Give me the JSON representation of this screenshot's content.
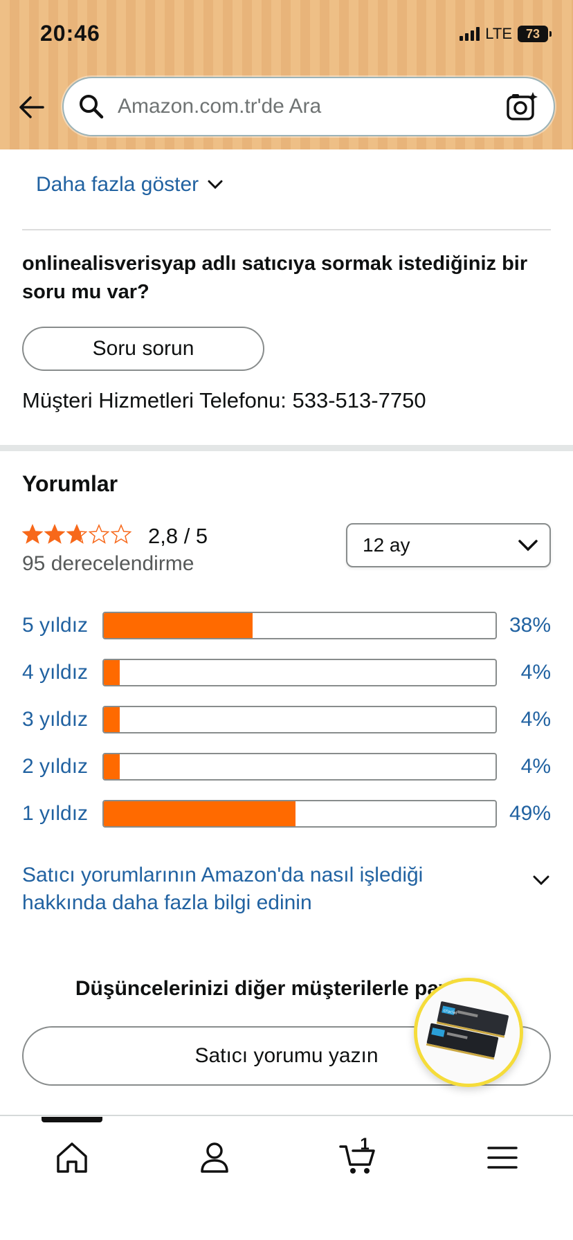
{
  "status_bar": {
    "time": "20:46",
    "network": "LTE",
    "battery": "73"
  },
  "search": {
    "placeholder": "Amazon.com.tr'de Ara"
  },
  "seller_info": {
    "show_more": "Daha fazla göster",
    "question": "onlinealisverisyap adlı satıcıya sormak istediğiniz bir soru mu var?",
    "ask_button": "Soru sorun",
    "phone": "Müşteri Hizmetleri Telefonu: 533-513-7750"
  },
  "reviews": {
    "title": "Yorumlar",
    "rating": "2,8 /  5",
    "stars_filled": 2.8,
    "rating_count": "95 derecelendirme",
    "period": "12 ay",
    "histogram": [
      {
        "label": "5 yıldız",
        "percent": "38%",
        "value": 38
      },
      {
        "label": "4 yıldız",
        "percent": "4%",
        "value": 4
      },
      {
        "label": "3 yıldız",
        "percent": "4%",
        "value": 4
      },
      {
        "label": "2 yıldız",
        "percent": "4%",
        "value": 4
      },
      {
        "label": "1 yıldız",
        "percent": "49%",
        "value": 49
      }
    ],
    "info_link": "Satıcı yorumlarının Amazon'da nasıl işlediği hakkında daha fazla bilgi edinin",
    "share_title": "Düşüncelerinizi diğer müşterilerle paylaşın",
    "write_button": "Satıcı yorumu yazın"
  },
  "product_bubble": {
    "logo_text": "crucial"
  },
  "bottom_nav": {
    "cart_count": "1"
  },
  "colors": {
    "accent": "#ff6a00",
    "link": "#2162a1",
    "star": "#f7681a"
  }
}
